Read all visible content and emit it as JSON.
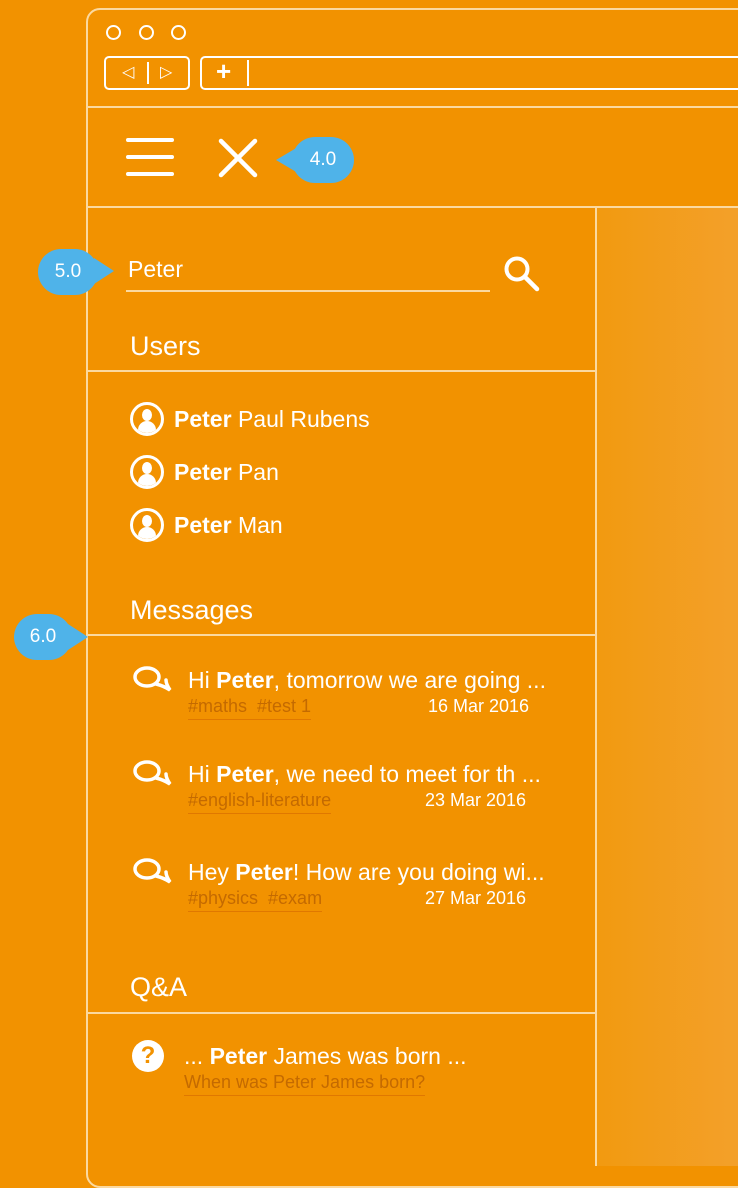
{
  "browser": {
    "nav_back": "◁",
    "nav_forward": "▷",
    "new_tab": "+"
  },
  "toolbar": {
    "menu_icon": "hamburger-icon",
    "close_icon": "close-icon"
  },
  "annotations": {
    "close": "4.0",
    "search": "5.0",
    "messages": "6.0"
  },
  "search": {
    "value": "Peter",
    "icon": "search-icon"
  },
  "users": {
    "title": "Users",
    "items": [
      {
        "highlight": "Peter",
        "rest": "Paul Rubens"
      },
      {
        "highlight": "Peter",
        "rest": "Pan"
      },
      {
        "highlight": "Peter",
        "rest": "Man"
      }
    ]
  },
  "messages": {
    "title": "Messages",
    "items": [
      {
        "prefix": "Hi ",
        "highlight": "Peter",
        "rest": ", tomorrow we are going ...",
        "tags": "#maths  #test 1",
        "date": "16 Mar 2016"
      },
      {
        "prefix": "Hi ",
        "highlight": "Peter",
        "rest": ", we need to meet for th ...",
        "tags": "#english-literature",
        "date": "23 Mar 2016"
      },
      {
        "prefix": "Hey ",
        "highlight": "Peter",
        "rest": "! How are you doing wi...",
        "tags": "#physics  #exam",
        "date": "27 Mar 2016"
      }
    ]
  },
  "qa": {
    "title": "Q&A",
    "items": [
      {
        "prefix": "... ",
        "highlight": "Peter",
        "rest": " James was born ...",
        "link": "When was Peter James born?"
      }
    ]
  },
  "colors": {
    "background": "#F29200",
    "badge": "#4FB3E9",
    "divider": "#FBD9A0",
    "tag": "#C46A00"
  }
}
